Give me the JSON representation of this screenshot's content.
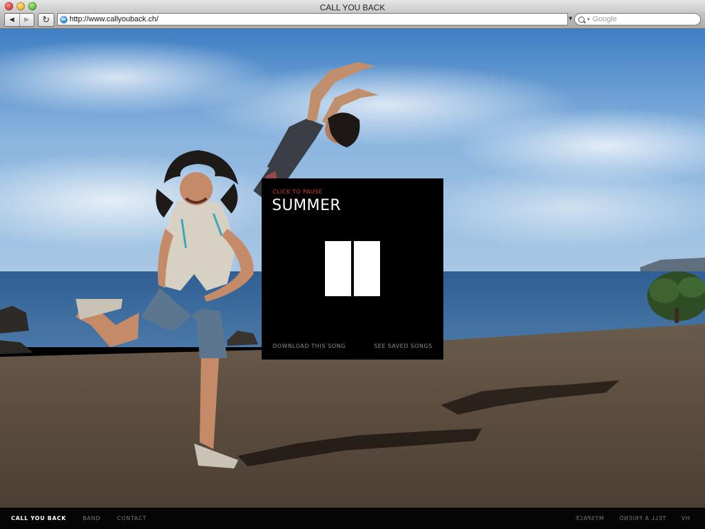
{
  "window": {
    "title": "CALL YOU BACK"
  },
  "toolbar": {
    "back_icon": "back-arrow-icon",
    "forward_icon": "forward-arrow-icon",
    "reload_icon": "reload-icon",
    "url": "http://www.callyouback.ch/",
    "search_placeholder": "Google"
  },
  "player": {
    "status": "CLICK TO PAUSE",
    "song_title": "SUMMER",
    "download_label": "DOWNLOAD THIS SONG",
    "saved_label": "SEE SAVED SONGS",
    "accent_color": "#e23b2d"
  },
  "footer": {
    "brand": "CALL YOU BACK",
    "left_links": [
      "BAND",
      "CONTACT"
    ],
    "right_links": [
      "HV",
      "TELL A FRIEND",
      "MYSPACE"
    ]
  }
}
